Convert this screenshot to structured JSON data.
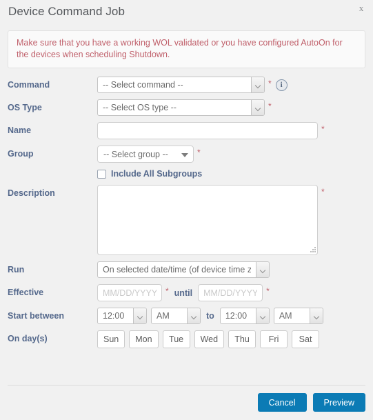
{
  "dialog": {
    "title": "Device Command Job",
    "close_label": "x"
  },
  "warning": {
    "text": "Make sure that you have a working WOL validated or you have configured AutoOn for the devices when scheduling Shutdown."
  },
  "form": {
    "command": {
      "label": "Command",
      "value": "-- Select command --",
      "required_marker": "*",
      "info_glyph": "i"
    },
    "os_type": {
      "label": "OS Type",
      "value": "-- Select OS type --",
      "required_marker": "*"
    },
    "name": {
      "label": "Name",
      "value": "",
      "placeholder": "",
      "required_marker": "*"
    },
    "group": {
      "label": "Group",
      "value": "-- Select group --",
      "required_marker": "*"
    },
    "include_subgroups": {
      "label": "Include All Subgroups",
      "checked": false
    },
    "description": {
      "label": "Description",
      "value": "",
      "placeholder": "",
      "required_marker": "*"
    },
    "run": {
      "label": "Run",
      "value": "On selected date/time (of device time zo"
    },
    "effective": {
      "label": "Effective",
      "from_placeholder": "MM/DD/YYYY",
      "from_value": "",
      "until_label": "until",
      "to_placeholder": "MM/DD/YYYY",
      "to_value": "",
      "required_marker": "*"
    },
    "start_between": {
      "label": "Start between",
      "from_time": "12:00",
      "from_meridiem": "AM",
      "to_word": "to",
      "to_time": "12:00",
      "to_meridiem": "AM"
    },
    "on_days": {
      "label": "On day(s)",
      "days": [
        "Sun",
        "Mon",
        "Tue",
        "Wed",
        "Thu",
        "Fri",
        "Sat"
      ]
    }
  },
  "footer": {
    "cancel_label": "Cancel",
    "preview_label": "Preview"
  },
  "colors": {
    "accent_blue": "#0b7bb5",
    "label_blue": "#55698c",
    "warning_red": "#c0606b",
    "page_bg": "#f1f1f1"
  }
}
